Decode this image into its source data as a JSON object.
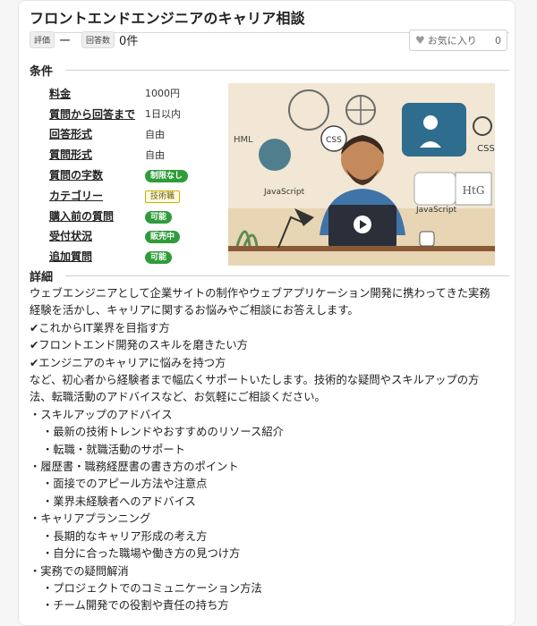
{
  "title": "フロントエンドエンジニアのキャリア相談",
  "meta": {
    "rating_label": "評価",
    "rating_value": "ー",
    "answers_label": "回答数",
    "answers_value": "0件"
  },
  "favorite": {
    "label": "お気に入り",
    "count": "0",
    "icon": "heart-icon"
  },
  "conditions": {
    "heading": "条件",
    "rows": [
      {
        "key": "料金",
        "value": "1000円",
        "style": "text"
      },
      {
        "key": "質問から回答まで",
        "value": "1日以内",
        "style": "text"
      },
      {
        "key": "回答形式",
        "value": "自由",
        "style": "text"
      },
      {
        "key": "質問形式",
        "value": "自由",
        "style": "text"
      },
      {
        "key": "質問の字数",
        "value": "制限なし",
        "style": "green"
      },
      {
        "key": "カテゴリー",
        "value": "技術職",
        "style": "yellow"
      },
      {
        "key": "購入前の質問",
        "value": "可能",
        "style": "green"
      },
      {
        "key": "受付状況",
        "value": "販売中",
        "style": "green"
      },
      {
        "key": "追加質問",
        "value": "可能",
        "style": "green"
      }
    ]
  },
  "image_labels": {
    "html": "HML",
    "css1": "CSS",
    "css2": "CSS",
    "js1": "JavaScript",
    "js2": "JavaScript",
    "htg": "HtG"
  },
  "detail": {
    "heading": "詳細",
    "lines": [
      {
        "text": "ウェブエンジニアとして企業サイトの制作やウェブアプリケーション開発に携わってきた実務",
        "indent": 0
      },
      {
        "text": "経験を活かし、キャリアに関するお悩みやご相談にお答えします。",
        "indent": 0
      },
      {
        "text": "✔これからIT業界を目指す方",
        "indent": 0
      },
      {
        "text": "✔フロントエンド開発のスキルを磨きたい方",
        "indent": 0
      },
      {
        "text": "✔エンジニアのキャリアに悩みを持つ方",
        "indent": 0
      },
      {
        "text": "など、初心者から経験者まで幅広くサポートいたします。技術的な疑問やスキルアップの方",
        "indent": 0
      },
      {
        "text": "法、転職活動のアドバイスなど、お気軽にご相談ください。",
        "indent": 0
      },
      {
        "text": "・スキルアップのアドバイス",
        "indent": 1
      },
      {
        "text": "・最新の技術トレンドやおすすめのリソース紹介",
        "indent": 2
      },
      {
        "text": "・転職・就職活動のサポート",
        "indent": 2
      },
      {
        "text": "・履歴書・職務経歴書の書き方のポイント",
        "indent": 1
      },
      {
        "text": "・面接でのアピール方法や注意点",
        "indent": 2
      },
      {
        "text": "・業界未経験者へのアドバイス",
        "indent": 2
      },
      {
        "text": "・キャリアプランニング",
        "indent": 1
      },
      {
        "text": "・長期的なキャリア形成の考え方",
        "indent": 2
      },
      {
        "text": "・自分に合った職場や働き方の見つけ方",
        "indent": 2
      },
      {
        "text": "・実務での疑問解消",
        "indent": 1
      },
      {
        "text": "・プロジェクトでのコミュニケーション方法",
        "indent": 2
      },
      {
        "text": "・チーム開発での役割や責任の持ち方",
        "indent": 2
      }
    ]
  }
}
